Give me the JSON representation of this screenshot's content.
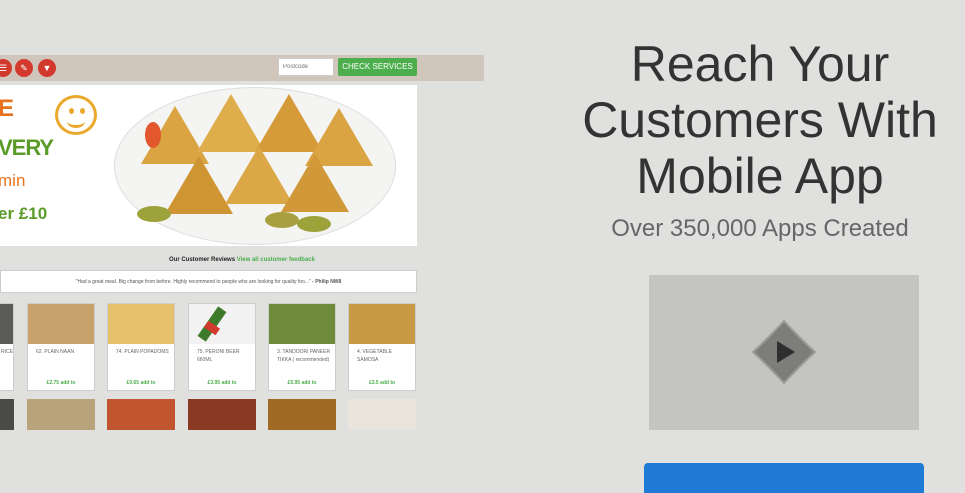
{
  "screenshot": {
    "postcode_placeholder": "Postcode",
    "check_services_label": "CHECK SERVICES",
    "hero": {
      "line1": "E",
      "line2": "VERY",
      "line3": "min",
      "line4": "er £10"
    },
    "reviews": {
      "title": "Our Customer Reviews",
      "link": "View all customer feedback",
      "quote": "\"Had a great meal. Big change from before. Highly recommend to people who are looking for quality foo...\"",
      "author": "- Philip NW8"
    },
    "products": [
      {
        "name": "RICE",
        "price": ""
      },
      {
        "name": "62. PLAIN NAAN",
        "price": "£2.75 add to"
      },
      {
        "name": "74. PLAIN POPADOMS",
        "price": "£0.65 add to"
      },
      {
        "name": "75. PERONI BEER 660ML",
        "price": "£3.95 add to"
      },
      {
        "name": "3. TANDOORI PANEER TIKKA ( recommended)",
        "price": "£5.95 add to"
      },
      {
        "name": "4. VEGETABLE SAMOSA",
        "price": "£3.5 add to"
      }
    ]
  },
  "headline": {
    "line1": "Reach Your",
    "line2": "Customers With",
    "line3": "Mobile App"
  },
  "subheadline": "Over 350,000 Apps Created",
  "colors": {
    "accent_green": "#4cae4c",
    "cta_blue": "#1f7bd6",
    "icon_red": "#d13a2d"
  }
}
